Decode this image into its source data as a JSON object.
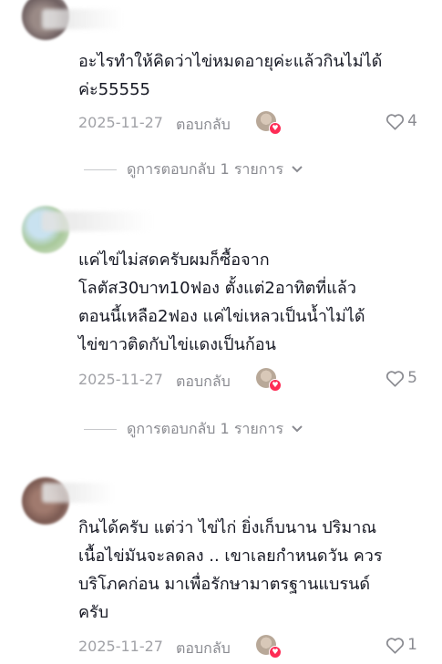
{
  "comments": [
    {
      "text": "อะไรทำให้คิดว่าไข่หมดอายุค่ะแล้วกินไม่ได้\nค่ะ55555",
      "date": "2025-11-27",
      "reply_label": "ตอบกลับ",
      "likes": "4",
      "view_replies": "ดูการตอบกลับ 1 รายการ"
    },
    {
      "text": "แค่ไข่ไม่สดครับผมก็ซื้อจาก\nโลตัส30บาท10ฟอง ตั้งแต่2อาทิตที่แล้ว\nตอนนี้เหลือ2ฟอง แค่ไข่เหลวเป็นน้ำไม่ได้\nไข่ขาวติดกับไข่แดงเป็นก้อน",
      "date": "2025-11-27",
      "reply_label": "ตอบกลับ",
      "likes": "5",
      "view_replies": "ดูการตอบกลับ 1 รายการ"
    },
    {
      "text": "กินได้ครับ แต่ว่า ไข่ไก่ ยิ่งเก็บนาน ปริมาณ\nเนื้อไข่มันจะลดลง .. เขาเลยกำหนดวัน ควร\nบริโภคก่อน มาเพื่อรักษามาตรฐานแบรนด์\nครับ",
      "date": "2025-11-27",
      "reply_label": "ตอบกลับ",
      "likes": "1"
    }
  ],
  "colors": {
    "text": "#161823",
    "secondary": "#8a8b91",
    "date": "#a1a2a7",
    "heart_badge": "#fe2c55"
  },
  "icons": {
    "like": "heart-outline-icon",
    "expand": "chevron-down-icon",
    "creator_like": "red-heart-badge-icon"
  }
}
